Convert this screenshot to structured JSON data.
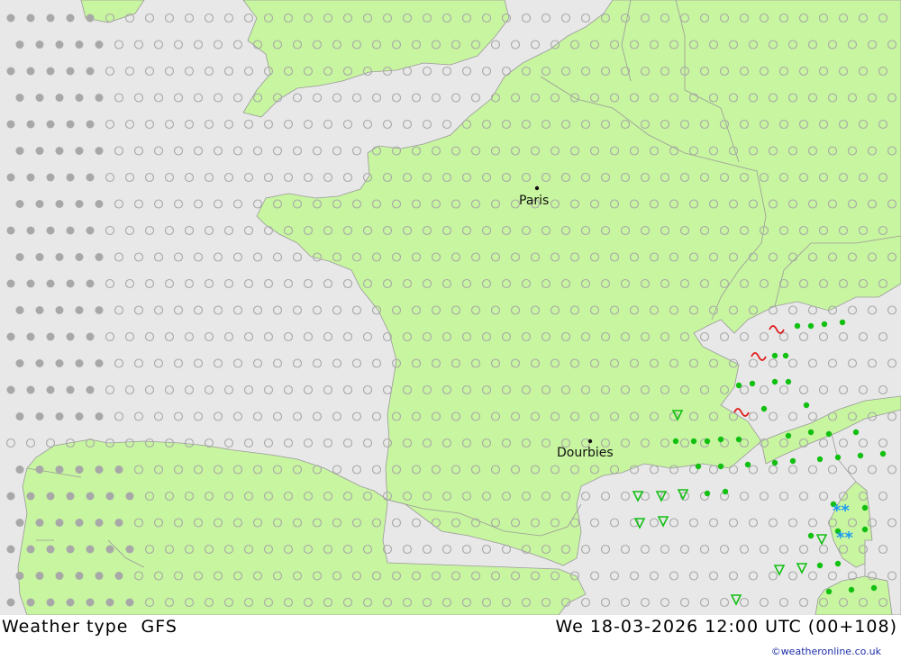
{
  "footer": {
    "title": "Weather type  GFS",
    "datetime": "We 18-03-2026 12:00 UTC (00+108)",
    "credit": "©weatheronline.co.uk"
  },
  "cities": [
    {
      "name": "Paris"
    },
    {
      "name": "Dourbies"
    }
  ],
  "colors": {
    "sea": "#e8e8e8",
    "land": "#c8f5a0",
    "border": "#9a9a9a",
    "dot_gray": "#a8a8a8",
    "rain_green": "#12c012",
    "thunder_red": "#e01818",
    "snow_blue": "#1e9cf0"
  },
  "legend_symbols": [
    "clear-circle",
    "half-cloud",
    "overcast-dot",
    "drizzle",
    "rain",
    "showers",
    "thunderstorm",
    "snow"
  ]
}
